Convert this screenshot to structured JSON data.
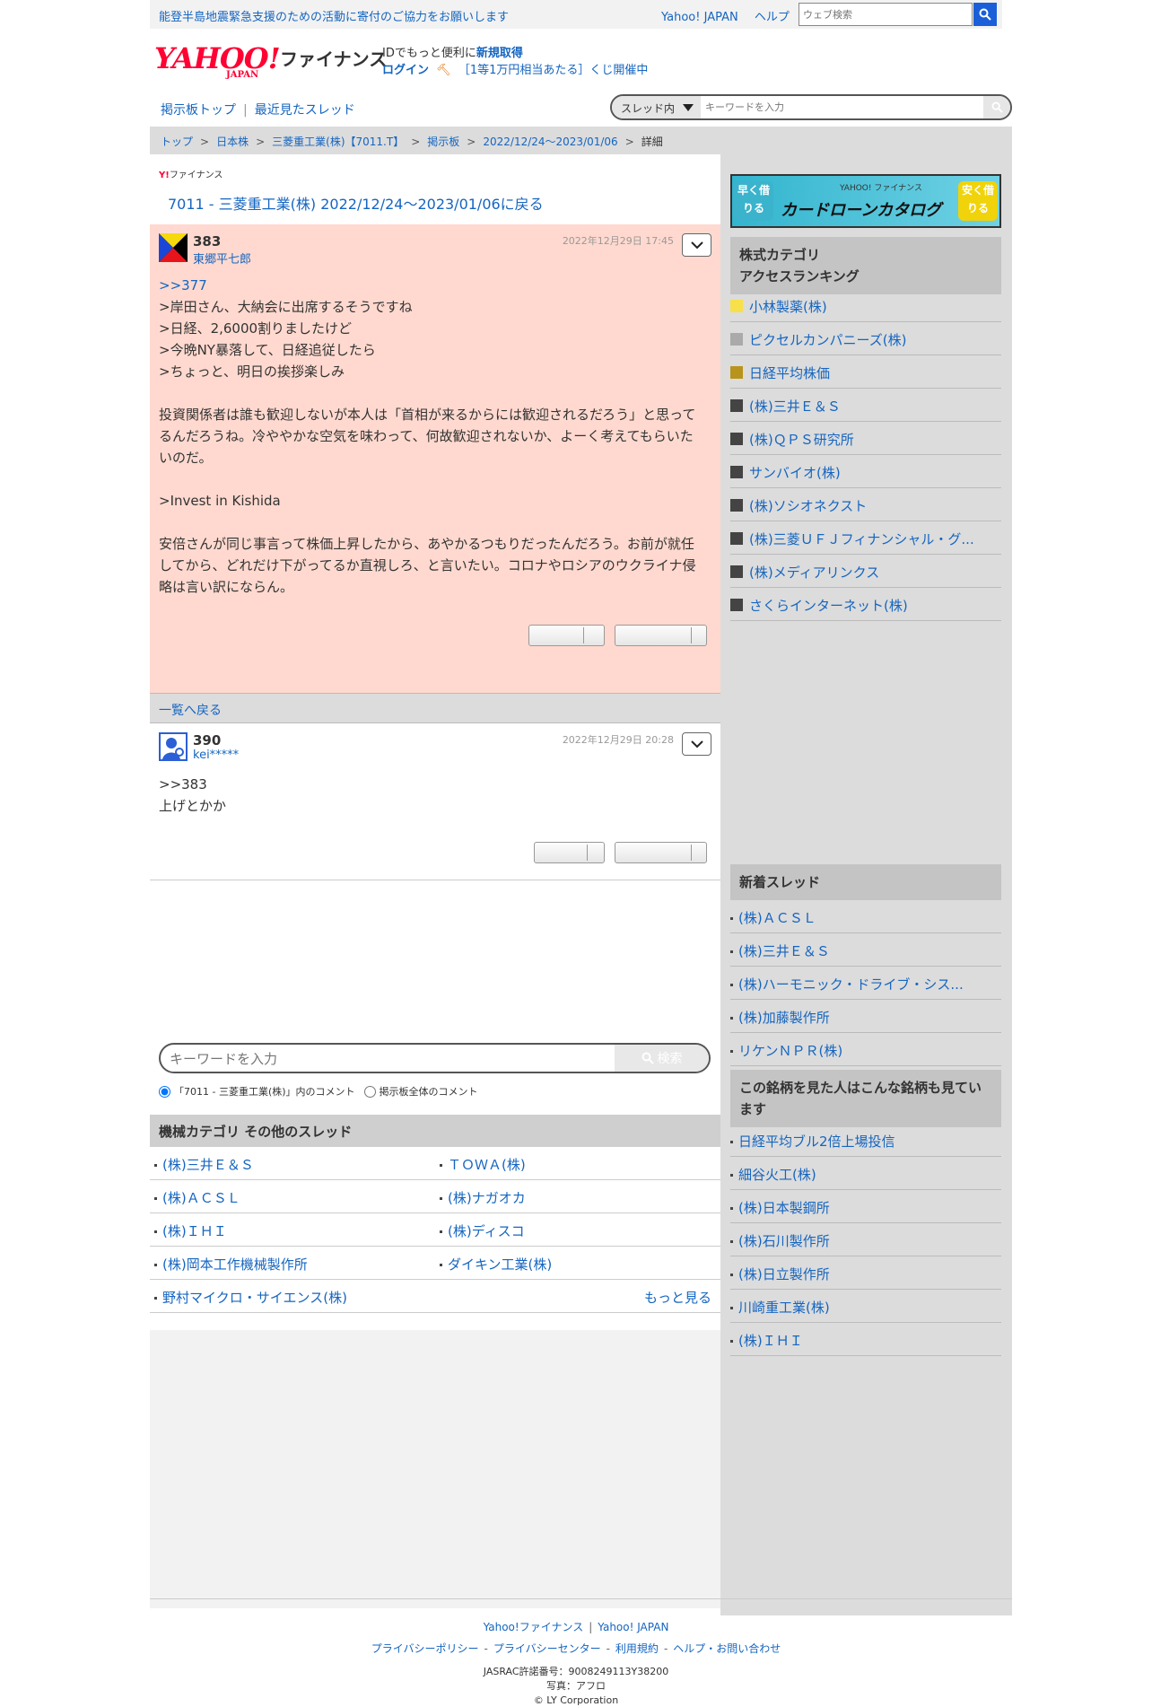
{
  "topbar": {
    "notice": "能登半島地震緊急支援のための活動に寄付のご協力をお願いします",
    "links": [
      "Yahoo! JAPAN",
      "ヘルプ"
    ],
    "search_placeholder": "ウェブ検索"
  },
  "header": {
    "logo_text": "YAHOO!",
    "logo_sub": "JAPAN",
    "logo_service": "ファイナンス",
    "id_prefix": "IDでもっと便利に",
    "id_link": "新規取得",
    "login": "ログイン",
    "lottery": "［1等1万円相当あたる］くじ開催中"
  },
  "subnav": {
    "board_top": "掲示板トップ",
    "recent": "最近見たスレッド",
    "scope": "スレッド内",
    "keyword_placeholder": "キーワードを入力"
  },
  "breadcrumb": [
    "トップ",
    "日本株",
    "三菱重工業(株)【7011.T】",
    "掲示板",
    "2022/12/24〜2023/01/06",
    "詳細"
  ],
  "main": {
    "small_logo_y": "Y!",
    "small_logo_text": "ファイナンス",
    "back_title": "7011 - 三菱重工業(株) 2022/12/24〜2023/01/06に戻る",
    "back_to_list": "一覧へ戻る"
  },
  "posts": [
    {
      "number": "383",
      "author": "東郷平七郎",
      "date": "2022年12月29日 17:45",
      "anchor": ">>377",
      "lines": [
        ">岸田さん、大納会に出席するそうですね",
        ">日経、2,6000割りましたけど",
        ">今晩NY暴落して、日経追従したら",
        ">ちょっと、明日の挨拶楽しみ",
        "",
        "投資関係者は誰も歓迎しないが本人は「首相が来るからには歓迎されるだろう」と思ってるんだろうね。冷ややかな空気を味わって、何故歓迎されないか、よーく考えてもらいたいのだ。",
        "",
        ">Invest in Kishida",
        "",
        "安倍さんが同じ事言って株価上昇したから、あやかるつもりだったんだろう。お前が就任してから、どれだけ下がってるか直視しろ、と言いたい。コロナやロシアのウクライナ侵略は言い訳にならん。"
      ]
    },
    {
      "number": "390",
      "author": "kei*****",
      "date": "2022年12月29日 20:28",
      "anchor": ">>383",
      "lines": [
        "上げとかか"
      ]
    }
  ],
  "comment_search": {
    "placeholder": "キーワードを入力",
    "button": "検索",
    "radio_thread": "「7011 - 三菱重工業(株)」内のコメント",
    "radio_all": "掲示板全体のコメント"
  },
  "category": {
    "title": "機械カテゴリ その他のスレッド",
    "items": [
      "(株)三井Ｅ＆Ｓ",
      "ＴＯＷＡ(株)",
      "(株)ＡＣＳＬ",
      "(株)ナガオカ",
      "(株)ＩＨＩ",
      "(株)ディスコ",
      "(株)岡本工作機械製作所",
      "ダイキン工業(株)",
      "野村マイクロ・サイエンス(株)"
    ],
    "more": "もっと見る"
  },
  "sidebar": {
    "ad": {
      "left": "早く借りる",
      "top": "YAHOO! ファイナンス",
      "main": "カードローンカタログ",
      "right": "安く借りる"
    },
    "ranking_title_1": "株式カテゴリ",
    "ranking_title_2": "アクセスランキング",
    "ranking": [
      {
        "name": "小林製薬(株)",
        "color": "#f7e04a"
      },
      {
        "name": "ピクセルカンパニーズ(株)",
        "color": "#aaaaaa"
      },
      {
        "name": "日経平均株価",
        "color": "#b8941c"
      },
      {
        "name": "(株)三井Ｅ＆Ｓ",
        "color": "#444444"
      },
      {
        "name": "(株)ＱＰＳ研究所",
        "color": "#444444"
      },
      {
        "name": "サンバイオ(株)",
        "color": "#444444"
      },
      {
        "name": "(株)ソシオネクスト",
        "color": "#444444"
      },
      {
        "name": "(株)三菱ＵＦＪフィナンシャル・グ...",
        "color": "#444444"
      },
      {
        "name": "(株)メディアリンクス",
        "color": "#444444"
      },
      {
        "name": "さくらインターネット(株)",
        "color": "#444444"
      }
    ],
    "new_threads_title": "新着スレッド",
    "new_threads": [
      "(株)ＡＣＳＬ",
      "(株)三井Ｅ＆Ｓ",
      "(株)ハーモニック・ドライブ・シス...",
      "(株)加藤製作所",
      "リケンＮＰＲ(株)"
    ],
    "also_viewed_title": "この銘柄を見た人はこんな銘柄も見ています",
    "also_viewed": [
      "日経平均ブル2倍上場投信",
      "細谷火工(株)",
      "(株)日本製鋼所",
      "(株)石川製作所",
      "(株)日立製作所",
      "川崎重工業(株)",
      "(株)ＩＨＩ"
    ]
  },
  "footer": {
    "links1": [
      "Yahoo!ファイナンス",
      "Yahoo! JAPAN"
    ],
    "links2": [
      "プライバシーポリシー",
      "プライバシーセンター",
      "利用規約",
      "ヘルプ・お問い合わせ"
    ],
    "jasrac": "JASRAC許諾番号：9008249113Y38200",
    "photo": "写真：アフロ",
    "copyright": "© LY Corporation"
  }
}
